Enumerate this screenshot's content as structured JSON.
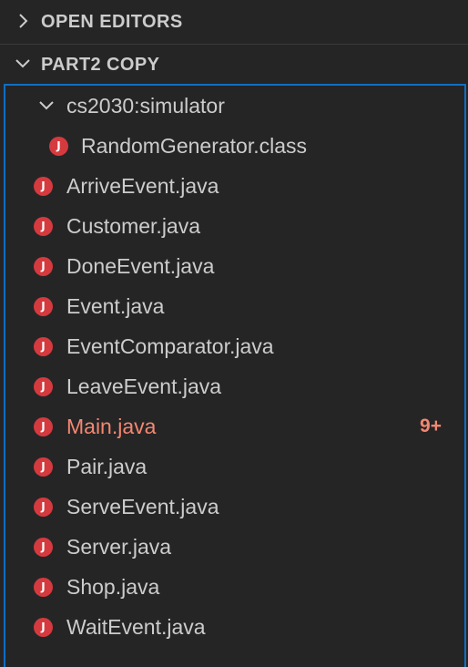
{
  "sections": {
    "open_editors": {
      "title": "OPEN EDITORS",
      "expanded": false
    },
    "workspace": {
      "title": "PART2 COPY",
      "expanded": true
    }
  },
  "folder": {
    "name": "cs2030:simulator",
    "expanded": true
  },
  "folder_files": [
    {
      "name": "RandomGenerator.class",
      "icon": "java-file-icon"
    }
  ],
  "files": [
    {
      "name": "ArriveEvent.java",
      "icon": "java-file-icon"
    },
    {
      "name": "Customer.java",
      "icon": "java-file-icon"
    },
    {
      "name": "DoneEvent.java",
      "icon": "java-file-icon"
    },
    {
      "name": "Event.java",
      "icon": "java-file-icon"
    },
    {
      "name": "EventComparator.java",
      "icon": "java-file-icon"
    },
    {
      "name": "LeaveEvent.java",
      "icon": "java-file-icon"
    },
    {
      "name": "Main.java",
      "icon": "java-file-icon",
      "status": "error",
      "badge": "9+"
    },
    {
      "name": "Pair.java",
      "icon": "java-file-icon"
    },
    {
      "name": "ServeEvent.java",
      "icon": "java-file-icon"
    },
    {
      "name": "Server.java",
      "icon": "java-file-icon"
    },
    {
      "name": "Shop.java",
      "icon": "java-file-icon"
    },
    {
      "name": "WaitEvent.java",
      "icon": "java-file-icon"
    }
  ],
  "icon_glyph": "J",
  "colors": {
    "background": "#252526",
    "text": "#cccccc",
    "error": "#f48771",
    "java_icon": "#d53a3e",
    "focus_border": "#0e6fc4"
  }
}
